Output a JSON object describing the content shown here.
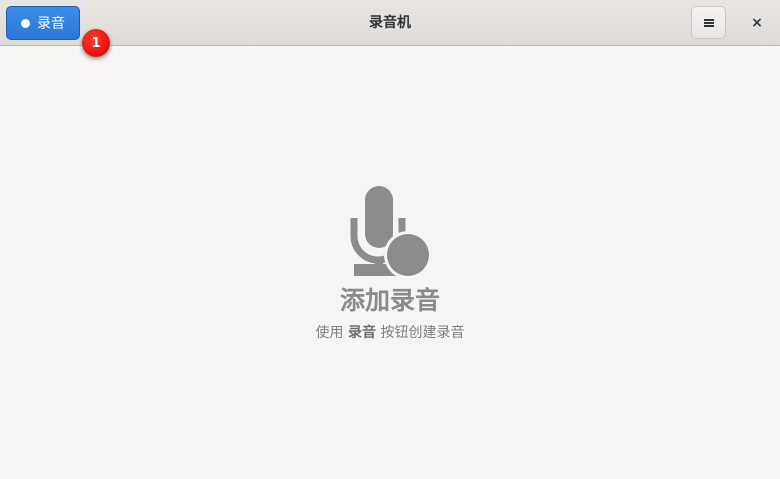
{
  "header": {
    "record_label": "录音",
    "title": "录音机",
    "close_symbol": "×",
    "badge_number": "1"
  },
  "empty_state": {
    "title": "添加录音",
    "desc_before": "使用 ",
    "desc_bold": "录音",
    "desc_after": " 按钮创建录音"
  },
  "icons": {
    "record": "record-dot-icon",
    "menu": "hamburger-menu-icon",
    "close": "close-icon",
    "empty": "microphone-record-icon"
  },
  "colors": {
    "accent": "#2a76d9",
    "badge": "#e00000",
    "icon_gray": "#8c8c8c"
  }
}
